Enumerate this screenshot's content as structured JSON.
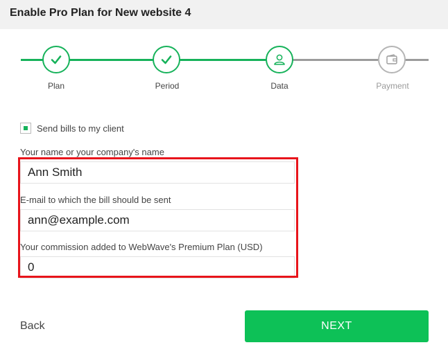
{
  "header": {
    "title": "Enable Pro Plan for New website 4"
  },
  "stepper": {
    "steps": [
      {
        "label": "Plan",
        "state": "done",
        "icon": "checkmark-icon"
      },
      {
        "label": "Period",
        "state": "done",
        "icon": "checkmark-icon"
      },
      {
        "label": "Data",
        "state": "current",
        "icon": "user-icon"
      },
      {
        "label": "Payment",
        "state": "pending",
        "icon": "wallet-icon"
      }
    ],
    "colors": {
      "active": "#16b25a",
      "inactive": "#9b9b9b"
    }
  },
  "form": {
    "send_bills": {
      "label": "Send bills to my client",
      "checked": true
    },
    "name": {
      "label": "Your name or your company's name",
      "value": "Ann Smith"
    },
    "email": {
      "label": "E-mail to which the bill should be sent",
      "value": "ann@example.com"
    },
    "commission": {
      "label": "Your commission added to WebWave's Premium Plan (USD)",
      "value": "0"
    }
  },
  "footer": {
    "back_label": "Back",
    "next_label": "NEXT"
  },
  "colors": {
    "accent": "#0dc157",
    "highlight": "#e8141b"
  }
}
